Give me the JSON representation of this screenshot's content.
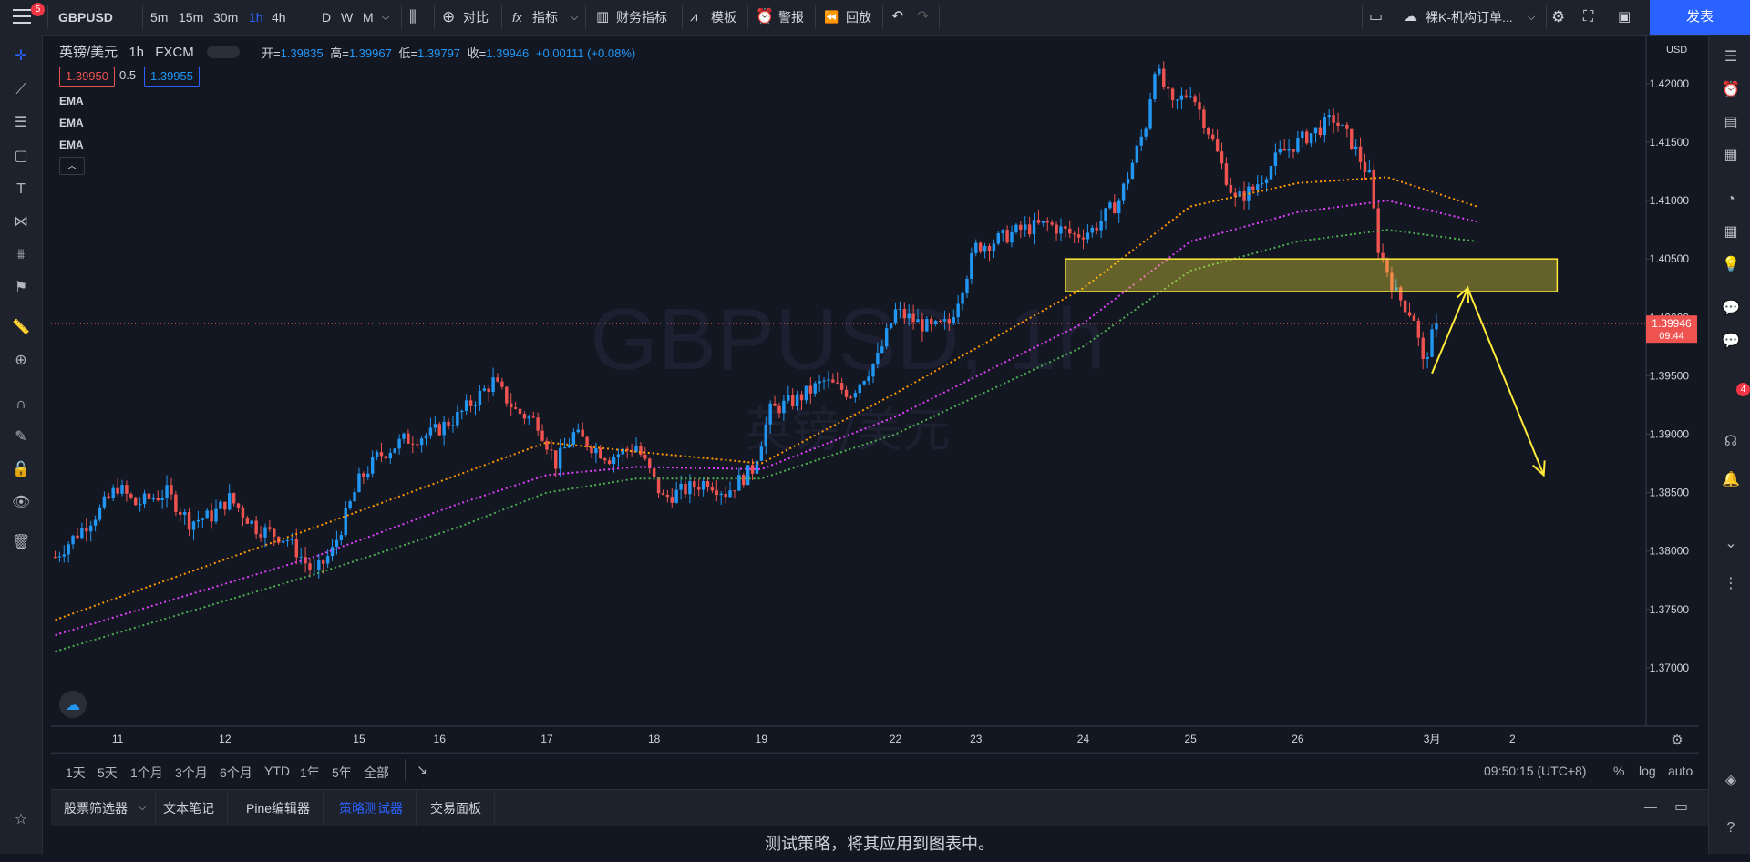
{
  "topbar": {
    "notif_count": "5",
    "symbol": "GBPUSD",
    "intervals": [
      "5m",
      "15m",
      "30m",
      "1h",
      "4h",
      "D",
      "W",
      "M"
    ],
    "active_interval": "1h",
    "compare": "对比",
    "indicators": "指标",
    "financials": "财务指标",
    "templates": "模板",
    "alerts": "警报",
    "replay": "回放",
    "layout_name": "裸K-机构订单...",
    "publish": "发表"
  },
  "legend": {
    "name": "英镑/美元",
    "interval": "1h",
    "source": "FXCM",
    "open_label": "开=",
    "open": "1.39835",
    "high_label": "高=",
    "high": "1.39967",
    "low_label": "低=",
    "low": "1.39797",
    "close_label": "收=",
    "close": "1.39946",
    "change": "+0.00111 (+0.08%)",
    "bid": "1.39950",
    "spread": "0.5",
    "ask": "1.39955",
    "indicators": [
      "EMA",
      "EMA",
      "EMA"
    ]
  },
  "watermark": {
    "symbol": "GBPUSD, 1h",
    "name": "英镑/美元"
  },
  "colors": {
    "up": "#2196f3",
    "down": "#ef5350",
    "ema_fast": "#ff9800",
    "ema_mid": "#e040fb",
    "ema_slow": "#4caf50",
    "zone": "#ffeb3b",
    "accent": "#2962ff"
  },
  "chart_data": {
    "type": "candlestick",
    "y_unit_label": "USD",
    "ylim": [
      1.365,
      1.4242
    ],
    "yticks": [
      "1.42000",
      "1.41500",
      "1.41000",
      "1.40500",
      "1.40000",
      "1.39500",
      "1.39000",
      "1.38500",
      "1.38000",
      "1.37500",
      "1.37000"
    ],
    "ytick_values": [
      1.42,
      1.415,
      1.41,
      1.405,
      1.4,
      1.395,
      1.39,
      1.385,
      1.38,
      1.375,
      1.37
    ],
    "xticks": [
      {
        "label": "11",
        "bar": 14
      },
      {
        "label": "12",
        "bar": 38
      },
      {
        "label": "15",
        "bar": 68
      },
      {
        "label": "16",
        "bar": 86
      },
      {
        "label": "17",
        "bar": 110
      },
      {
        "label": "18",
        "bar": 134
      },
      {
        "label": "19",
        "bar": 158
      },
      {
        "label": "22",
        "bar": 188
      },
      {
        "label": "23",
        "bar": 206
      },
      {
        "label": "24",
        "bar": 230
      },
      {
        "label": "25",
        "bar": 254
      },
      {
        "label": "26",
        "bar": 278
      },
      {
        "label": "3月",
        "bar": 308
      },
      {
        "label": "2",
        "bar": 326
      }
    ],
    "bars_total": 356,
    "last_price": "1.39946",
    "countdown": "09:44",
    "last_value": 1.39946,
    "pivots": [
      [
        0,
        1.3795
      ],
      [
        10,
        1.3835
      ],
      [
        14,
        1.3855
      ],
      [
        18,
        1.384
      ],
      [
        25,
        1.385
      ],
      [
        30,
        1.3825
      ],
      [
        35,
        1.383
      ],
      [
        39,
        1.3845
      ],
      [
        45,
        1.382
      ],
      [
        52,
        1.381
      ],
      [
        58,
        1.378
      ],
      [
        62,
        1.38
      ],
      [
        68,
        1.386
      ],
      [
        72,
        1.388
      ],
      [
        78,
        1.3895
      ],
      [
        84,
        1.39
      ],
      [
        90,
        1.3915
      ],
      [
        98,
        1.3945
      ],
      [
        103,
        1.392
      ],
      [
        108,
        1.391
      ],
      [
        112,
        1.3875
      ],
      [
        116,
        1.39
      ],
      [
        124,
        1.388
      ],
      [
        130,
        1.389
      ],
      [
        136,
        1.3845
      ],
      [
        146,
        1.386
      ],
      [
        150,
        1.385
      ],
      [
        156,
        1.387
      ],
      [
        160,
        1.392
      ],
      [
        166,
        1.393
      ],
      [
        172,
        1.3945
      ],
      [
        178,
        1.3935
      ],
      [
        184,
        1.3965
      ],
      [
        188,
        1.4005
      ],
      [
        196,
        1.399
      ],
      [
        200,
        1.3995
      ],
      [
        206,
        1.406
      ],
      [
        210,
        1.4065
      ],
      [
        216,
        1.4075
      ],
      [
        222,
        1.408
      ],
      [
        228,
        1.407
      ],
      [
        232,
        1.4075
      ],
      [
        238,
        1.41
      ],
      [
        244,
        1.4165
      ],
      [
        246,
        1.4215
      ],
      [
        250,
        1.418
      ],
      [
        254,
        1.4195
      ],
      [
        258,
        1.416
      ],
      [
        264,
        1.41
      ],
      [
        268,
        1.411
      ],
      [
        274,
        1.414
      ],
      [
        280,
        1.4155
      ],
      [
        286,
        1.417
      ],
      [
        290,
        1.415
      ],
      [
        294,
        1.412
      ],
      [
        296,
        1.406
      ],
      [
        300,
        1.402
      ],
      [
        304,
        1.4
      ],
      [
        306,
        1.396
      ],
      [
        309,
        1.39946
      ]
    ],
    "ema_fast": [
      [
        0,
        1.3741
      ],
      [
        58,
        1.382
      ],
      [
        90,
        1.3865
      ],
      [
        110,
        1.3893
      ],
      [
        130,
        1.3885
      ],
      [
        158,
        1.3875
      ],
      [
        188,
        1.3935
      ],
      [
        230,
        1.4025
      ],
      [
        254,
        1.4095
      ],
      [
        278,
        1.4115
      ],
      [
        298,
        1.412
      ],
      [
        318,
        1.4095
      ]
    ],
    "ema_mid": [
      [
        0,
        1.3728
      ],
      [
        58,
        1.3795
      ],
      [
        90,
        1.384
      ],
      [
        110,
        1.3865
      ],
      [
        130,
        1.3872
      ],
      [
        158,
        1.387
      ],
      [
        188,
        1.3915
      ],
      [
        230,
        1.3995
      ],
      [
        254,
        1.4065
      ],
      [
        278,
        1.409
      ],
      [
        298,
        1.41
      ],
      [
        318,
        1.4082
      ]
    ],
    "ema_slow": [
      [
        0,
        1.3714
      ],
      [
        58,
        1.378
      ],
      [
        90,
        1.382
      ],
      [
        110,
        1.385
      ],
      [
        130,
        1.3862
      ],
      [
        158,
        1.3862
      ],
      [
        188,
        1.39
      ],
      [
        230,
        1.3975
      ],
      [
        254,
        1.404
      ],
      [
        278,
        1.4065
      ],
      [
        298,
        1.4075
      ],
      [
        318,
        1.4065
      ]
    ],
    "zone": {
      "bar_start": 226,
      "bar_end": 336,
      "price_top": 1.405,
      "price_bottom": 1.4022
    },
    "arrow": [
      [
        308,
        1.3952
      ],
      [
        316,
        1.4025
      ],
      [
        333,
        1.3865
      ]
    ]
  },
  "bottombar": {
    "ranges": [
      "1天",
      "5天",
      "1个月",
      "3个月",
      "6个月",
      "YTD",
      "1年",
      "5年",
      "全部"
    ],
    "time": "09:50:15 (UTC+8)",
    "pct": "%",
    "log": "log",
    "auto": "auto"
  },
  "panel": {
    "tabs": [
      "股票筛选器",
      "文本笔记",
      "Pine编辑器",
      "策略测试器",
      "交易面板"
    ],
    "active_tab": "策略测试器",
    "message": "测试策略，将其应用到图表中。"
  },
  "right_badge": "4"
}
